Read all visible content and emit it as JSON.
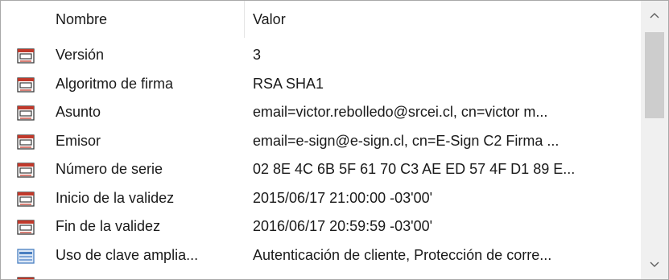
{
  "columns": {
    "name": "Nombre",
    "value": "Valor"
  },
  "rows": [
    {
      "name": "Versión",
      "value": "3",
      "icon": "certificate-field-icon"
    },
    {
      "name": "Algoritmo de firma",
      "value": "RSA SHA1",
      "icon": "certificate-field-icon"
    },
    {
      "name": "Asunto",
      "value": "email=victor.rebolledo@srcei.cl, cn=victor m...",
      "icon": "certificate-field-icon"
    },
    {
      "name": "Emisor",
      "value": "email=e-sign@e-sign.cl, cn=E-Sign C2 Firma ...",
      "icon": "certificate-field-icon"
    },
    {
      "name": "Número de serie",
      "value": "02 8E 4C 6B 5F 61 70 C3 AE ED 57 4F D1 89 E...",
      "icon": "certificate-field-icon"
    },
    {
      "name": "Inicio de la validez",
      "value": "2015/06/17 21:00:00 -03'00'",
      "icon": "certificate-field-icon"
    },
    {
      "name": "Fin de la validez",
      "value": "2016/06/17 20:59:59 -03'00'",
      "icon": "certificate-field-icon"
    },
    {
      "name": "Uso de clave amplia...",
      "value": "Autenticación de cliente, Protección de corre...",
      "icon": "extension-field-icon"
    }
  ],
  "colors": {
    "field_icon": "#c0392b",
    "extension_icon": "#4a7fc1",
    "scroll_thumb": "#cdcdcd"
  }
}
